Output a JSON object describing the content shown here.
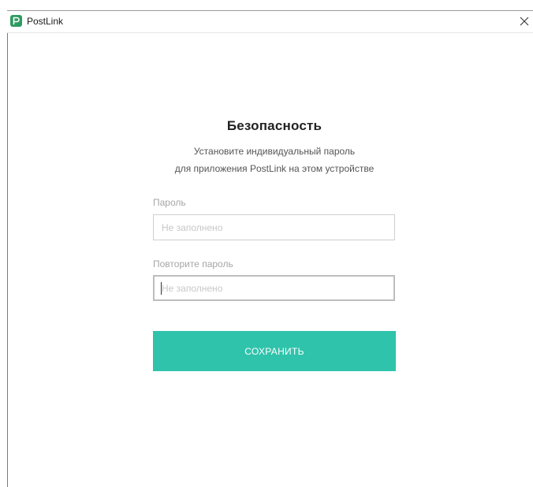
{
  "window": {
    "title": "PostLink",
    "logo_icon": "postlink-logo-icon",
    "close_icon": "close-icon",
    "logo_color": "#2d9b61"
  },
  "security_form": {
    "title": "Безопасность",
    "subtitle_line1": "Установите индивидуальный пароль",
    "subtitle_line2": "для приложения PostLink на этом устройстве",
    "password": {
      "label": "Пароль",
      "placeholder": "Не заполнено",
      "value": ""
    },
    "repeat_password": {
      "label": "Повторите пароль",
      "placeholder": "Не заполнено",
      "value": ""
    },
    "save_button_label": "СОХРАНИТЬ",
    "accent_color": "#2fc3ab"
  }
}
